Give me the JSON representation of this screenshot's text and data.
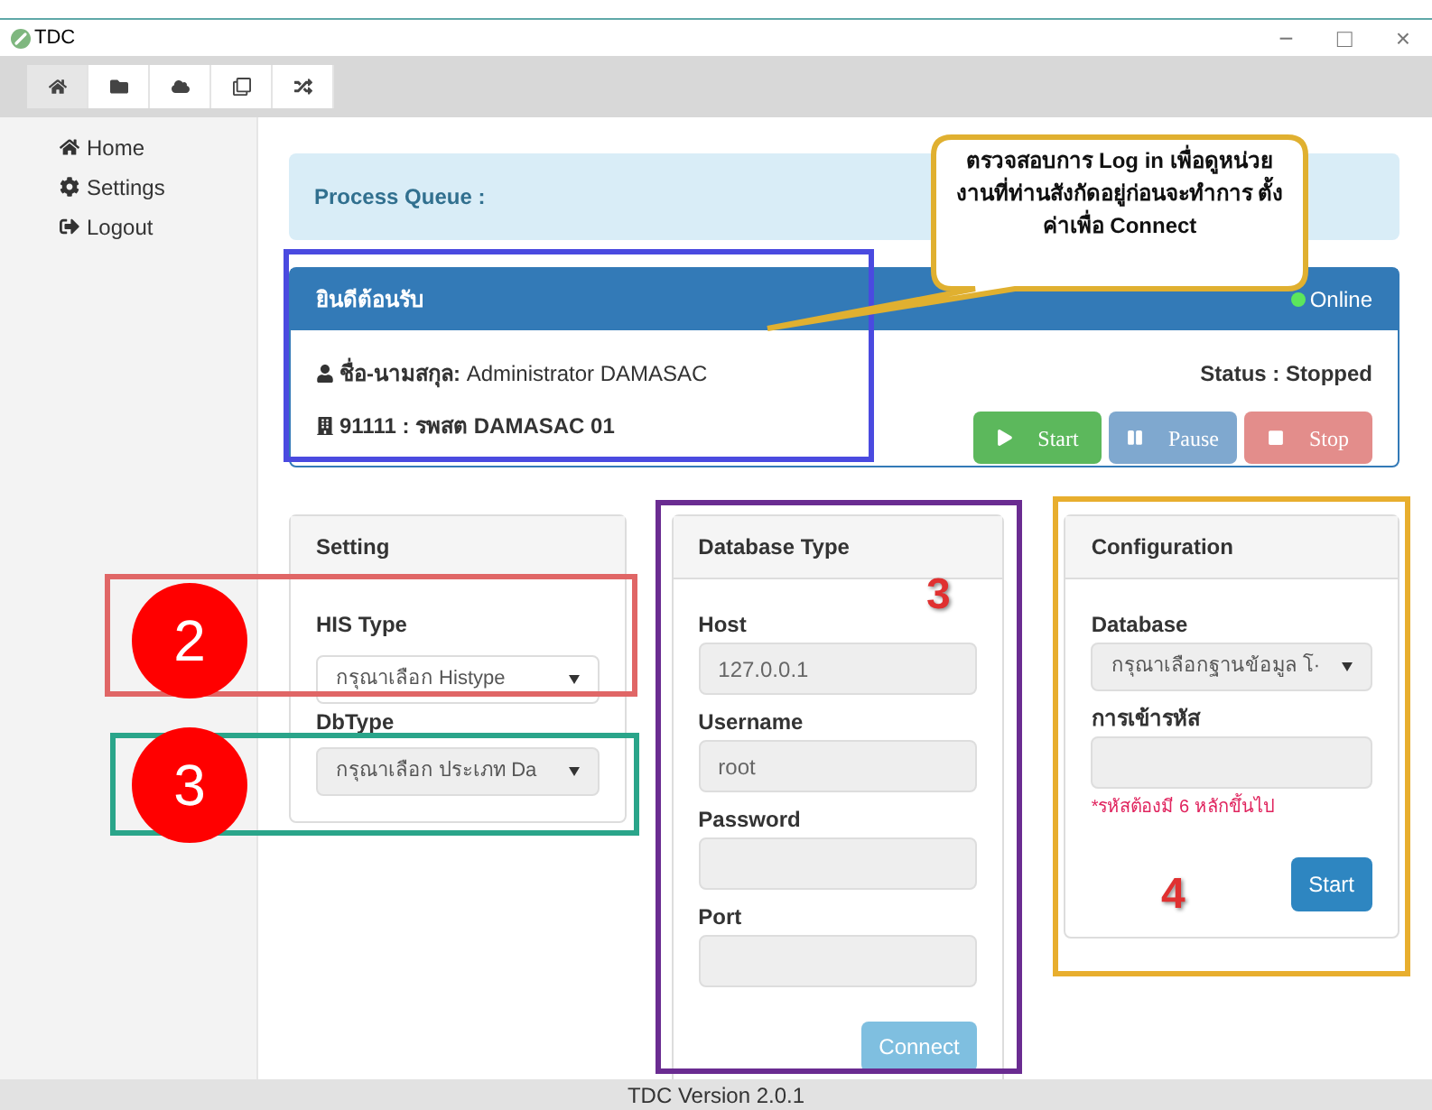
{
  "window": {
    "title": "TDC",
    "controls": [
      "−",
      "□",
      "×"
    ]
  },
  "toolbar": [
    {
      "kind": "home",
      "selected": true
    },
    {
      "kind": "folder",
      "selected": false
    },
    {
      "kind": "cloud",
      "selected": false
    },
    {
      "kind": "clone",
      "selected": false
    },
    {
      "kind": "shuffle",
      "selected": false
    }
  ],
  "sidebar": {
    "items": [
      {
        "kind": "home",
        "label": "Home"
      },
      {
        "kind": "settings",
        "label": "Settings"
      },
      {
        "kind": "logout",
        "label": "Logout"
      }
    ]
  },
  "process_queue": {
    "label": "Process Queue :"
  },
  "welcome": {
    "title": "ยินดีต้อนรับ",
    "online": true,
    "online_label": "Online",
    "name": "**ชื่อ-นามสกุล:** Administrator DAMASAC",
    "unit": "91111 : รพสต DAMASAC 01",
    "status": "Status : Stopped",
    "buttons": [
      {
        "kind": "play",
        "label": "Start",
        "disabled": false
      },
      {
        "kind": "pause",
        "label": "Pause",
        "disabled": true
      },
      {
        "kind": "stop",
        "label": "Stop",
        "disabled": true
      }
    ]
  },
  "setting": {
    "title": "Setting",
    "fields": [
      {
        "label": "HIS Type",
        "value": "กรุณาเลือก Histype",
        "disabled": false
      },
      {
        "label": "DbType",
        "value": "กรุณาเลือก ประเภท Da",
        "disabled": true
      }
    ]
  },
  "database_type": {
    "title": "Database Type",
    "fields": [
      {
        "label": "Host",
        "value": "127.0.0.1"
      },
      {
        "label": "Username",
        "value": "root"
      },
      {
        "label": "Password"
      },
      {
        "label": "Port"
      }
    ],
    "button": "Connect"
  },
  "configuration": {
    "title": "Configuration",
    "database_label": "Database",
    "database_value": "กรุณาเลือกฐานข้อมูล โ·",
    "encryption_label": "การเข้ารหัส",
    "hint": "*รหัสต้องมี 6 หลักขึ้นไป",
    "button": "Start"
  },
  "status_bar": {
    "text": "TDC Version 2.0.1"
  },
  "annotations": [
    {
      "kind": "box",
      "color": "#4a4ae0"
    },
    {
      "kind": "callout",
      "text": "ตรวจสอบการ Log in เพื่อดูหน่วยงานที่ท่านสังกัดอยู่ก่อนจะทำการ ตั้งค่าเพื่อ Connect"
    },
    {
      "kind": "box",
      "color": "#e06666"
    },
    {
      "kind": "box",
      "color": "#2aa58a"
    },
    {
      "kind": "box",
      "color": "#6a2c91"
    },
    {
      "kind": "box",
      "color": "#e8ae2e"
    },
    {
      "kind": "circle",
      "text": "2"
    },
    {
      "kind": "circle",
      "text": "3"
    },
    {
      "kind": "number",
      "text": "3"
    },
    {
      "kind": "number",
      "text": "4"
    }
  ]
}
